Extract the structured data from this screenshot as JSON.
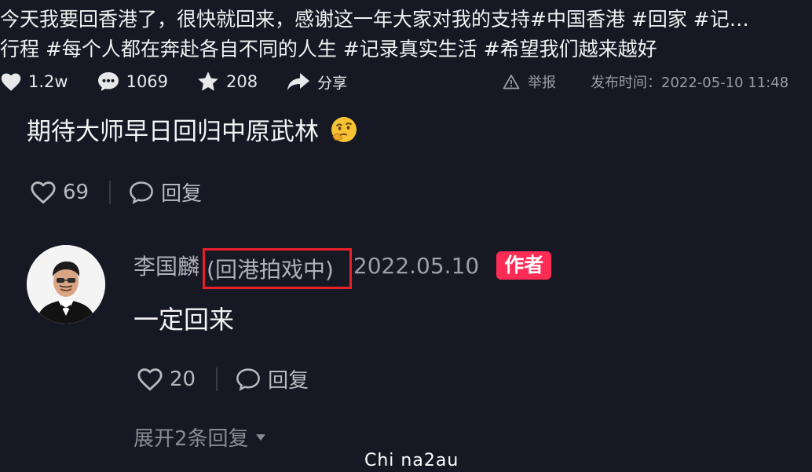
{
  "post": {
    "caption_line1": "今天我要回香港了，很快就回来，感谢这一年大家对我的支持#中国香港 #回家 #记…",
    "caption_line2": "行程 #每个人都在奔赴各自不同的人生 #记录真实生活 #希望我们越来越好"
  },
  "stats": {
    "likes": "1.2w",
    "comments": "1069",
    "favorites": "208",
    "share_label": "分享",
    "report_label": "举报",
    "publish_time": "发布时间：2022-05-10 11:48"
  },
  "comment": {
    "text": "期待大师早日回归中原武林",
    "likes": "69",
    "reply_label": "回复"
  },
  "reply": {
    "author": "李国麟",
    "author_note": "(回港拍戏中)",
    "date": "2022.05.10",
    "badge": "作者",
    "text": "一定回来",
    "likes": "20",
    "reply_label": "回复",
    "expand_label": "展开2条回复"
  },
  "watermark": "Chi na2au",
  "colors": {
    "background": "#161823",
    "badge": "#fe2c55",
    "highlight_box": "#e8202a"
  }
}
